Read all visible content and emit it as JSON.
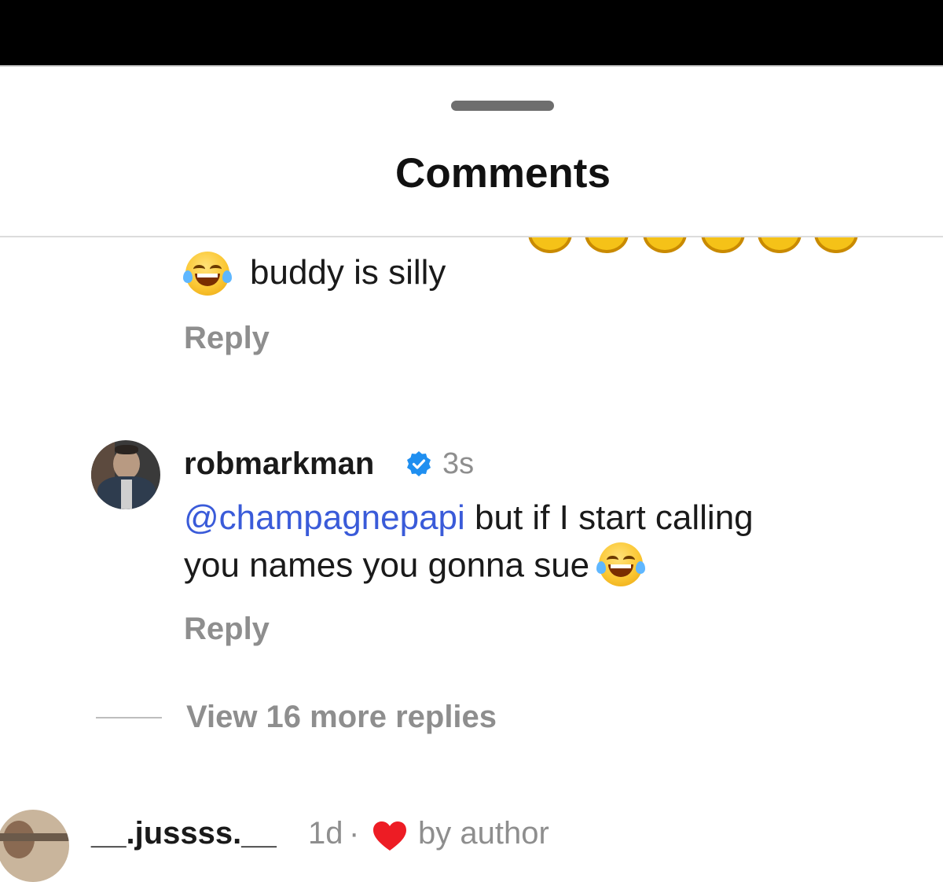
{
  "sheet": {
    "title": "Comments"
  },
  "comments": [
    {
      "text": "buddy is silly",
      "emoji": "face-with-tears-of-joy",
      "reply_label": "Reply"
    },
    {
      "username": "robmarkman",
      "verified": true,
      "time": "3s",
      "mention": "@champagnepapi",
      "text_line1": " but if I start calling",
      "text_line2": "you names you gonna sue ",
      "emoji": "face-with-tears-of-joy",
      "reply_label": "Reply"
    }
  ],
  "view_more": "View 16 more replies",
  "next_comment": {
    "username": "__.jussss.__",
    "time": "1d",
    "separator": "·",
    "liked_label": "by author",
    "heart_color": "#ed1c24"
  },
  "colors": {
    "mention": "#3a5bd9",
    "secondary_text": "#8e8e8e",
    "verified": "#1f8ff0"
  }
}
